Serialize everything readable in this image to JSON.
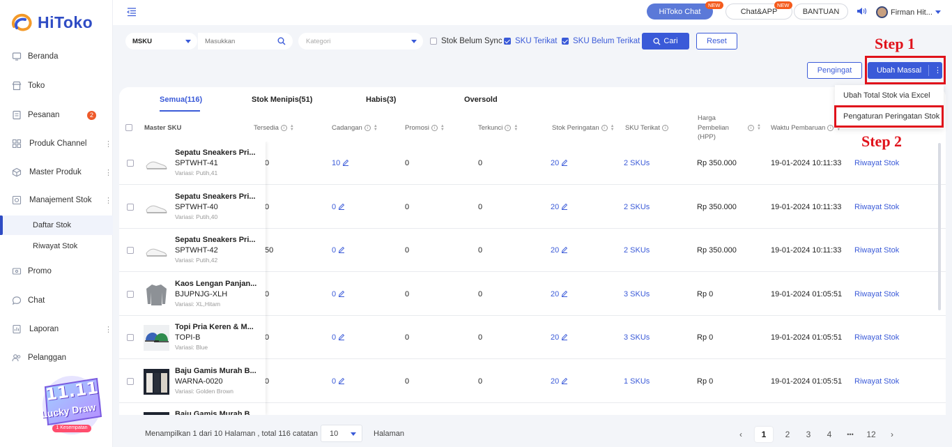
{
  "brand": {
    "name": "HiToko"
  },
  "sidebar": {
    "items": [
      {
        "label": "Beranda",
        "icon": "home-icon"
      },
      {
        "label": "Toko",
        "icon": "store-icon"
      },
      {
        "label": "Pesanan",
        "icon": "orders-icon",
        "badge": "2"
      },
      {
        "label": "Produk Channel",
        "icon": "grid-icon"
      },
      {
        "label": "Master Produk",
        "icon": "box-icon"
      },
      {
        "label": "Manajement Stok",
        "icon": "stock-icon"
      },
      {
        "label": "Promo",
        "icon": "promo-icon"
      },
      {
        "label": "Chat",
        "icon": "chat-icon"
      },
      {
        "label": "Laporan",
        "icon": "report-icon"
      },
      {
        "label": "Pelanggan",
        "icon": "customer-icon"
      }
    ],
    "subitems": [
      {
        "label": "Daftar Stok",
        "active": true
      },
      {
        "label": "Riwayat Stok",
        "active": false
      }
    ],
    "promo": {
      "line1": "11.11",
      "line2": "Lucky Draw",
      "line3": "1 Kesempatan"
    }
  },
  "header": {
    "hitoko_chat": "HiToko Chat",
    "chat_app": "Chat&APP",
    "new_tag": "NEW",
    "bantuan": "BANTUAN",
    "user_name": "Firman Hit..."
  },
  "filters": {
    "sku_select": "MSKU",
    "search_placeholder": "Masukkan",
    "category_placeholder": "Kategori",
    "checks": [
      {
        "label": "Stok Belum Sync",
        "checked": false
      },
      {
        "label": "SKU Terikat",
        "checked": true
      },
      {
        "label": "SKU Belum Terikat",
        "checked": true
      }
    ],
    "cari": "Cari",
    "reset": "Reset"
  },
  "actions": {
    "pengingat": "Pengingat",
    "ubah_massal": "Ubah Massal",
    "dropdown": [
      "Ubah Total Stok via Excel",
      "Pengaturan Peringatan Stok"
    ]
  },
  "annotations": {
    "step1": "Step 1",
    "step2": "Step 2"
  },
  "tabs": [
    "Semua(116)",
    "Stok Menipis(51)",
    "Habis(3)",
    "Oversold"
  ],
  "columns": {
    "master_sku": "Master SKU",
    "tersedia": "Tersedia",
    "cadangan": "Cadangan",
    "promosi": "Promosi",
    "terkunci": "Terkunci",
    "stok_peringatan": "Stok Peringatan",
    "sku_terikat": "SKU Terikat",
    "harga1": "Harga",
    "harga2": "Pembelian",
    "harga3": "(HPP)",
    "waktu": "Waktu Pembaruan"
  },
  "rows": [
    {
      "name": "Sepatu Sneakers Pri...",
      "sku": "SPTWHT-41",
      "variasi": "Variasi: Putih,41",
      "tersedia": "0",
      "cadangan": "10",
      "promosi": "0",
      "terkunci": "0",
      "peringatan": "20",
      "terikat": "2 SKUs",
      "harga": "Rp 350.000",
      "waktu": "19-01-2024 10:11:33",
      "riwayat": "Riwayat Stok",
      "thumb": "shoe"
    },
    {
      "name": "Sepatu Sneakers Pri...",
      "sku": "SPTWHT-40",
      "variasi": "Variasi: Putih,40",
      "tersedia": "0",
      "cadangan": "0",
      "promosi": "0",
      "terkunci": "0",
      "peringatan": "20",
      "terikat": "2 SKUs",
      "harga": "Rp 350.000",
      "waktu": "19-01-2024 10:11:33",
      "riwayat": "Riwayat Stok",
      "thumb": "shoe"
    },
    {
      "name": "Sepatu Sneakers Pri...",
      "sku": "SPTWHT-42",
      "variasi": "Variasi: Putih,42",
      "tersedia": "50",
      "cadangan": "0",
      "promosi": "0",
      "terkunci": "0",
      "peringatan": "20",
      "terikat": "2 SKUs",
      "harga": "Rp 350.000",
      "waktu": "19-01-2024 10:11:33",
      "riwayat": "Riwayat Stok",
      "thumb": "shoe"
    },
    {
      "name": "Kaos Lengan Panjan...",
      "sku": "BJUPNJG-XLH",
      "variasi": "Variasi: XL,Hitam",
      "tersedia": "0",
      "cadangan": "0",
      "promosi": "0",
      "terkunci": "0",
      "peringatan": "20",
      "terikat": "3 SKUs",
      "harga": "Rp 0",
      "waktu": "19-01-2024 01:05:51",
      "riwayat": "Riwayat Stok",
      "thumb": "shirt"
    },
    {
      "name": "Topi Pria Keren & M...",
      "sku": "TOPI-B",
      "variasi": "Variasi: Blue",
      "tersedia": "0",
      "cadangan": "0",
      "promosi": "0",
      "terkunci": "0",
      "peringatan": "20",
      "terikat": "3 SKUs",
      "harga": "Rp 0",
      "waktu": "19-01-2024 01:05:51",
      "riwayat": "Riwayat Stok",
      "thumb": "cap"
    },
    {
      "name": "Baju Gamis Murah B...",
      "sku": "WARNA-0020",
      "variasi": "Variasi: Golden Brown",
      "tersedia": "0",
      "cadangan": "0",
      "promosi": "0",
      "terkunci": "0",
      "peringatan": "20",
      "terikat": "1 SKUs",
      "harga": "Rp 0",
      "waktu": "19-01-2024 01:05:51",
      "riwayat": "Riwayat Stok",
      "thumb": "dress"
    },
    {
      "name": "Baju Gamis Murah B...",
      "sku": "",
      "variasi": "",
      "tersedia": "",
      "cadangan": "",
      "promosi": "",
      "terkunci": "",
      "peringatan": "",
      "terikat": "",
      "harga": "",
      "waktu": "",
      "riwayat": "",
      "thumb": "dress"
    }
  ],
  "pagination": {
    "summary": "Menampilkan 1 dari 10 Halaman , total 116 catatan",
    "page_size": "10",
    "halaman": "Halaman",
    "pages": [
      "1",
      "2",
      "3",
      "4",
      "•••",
      "12"
    ],
    "prev": "‹",
    "next": "›"
  },
  "colors": {
    "primary": "#3a5ad8",
    "annotation": "#e0121b",
    "badge": "#ee5a2a"
  }
}
